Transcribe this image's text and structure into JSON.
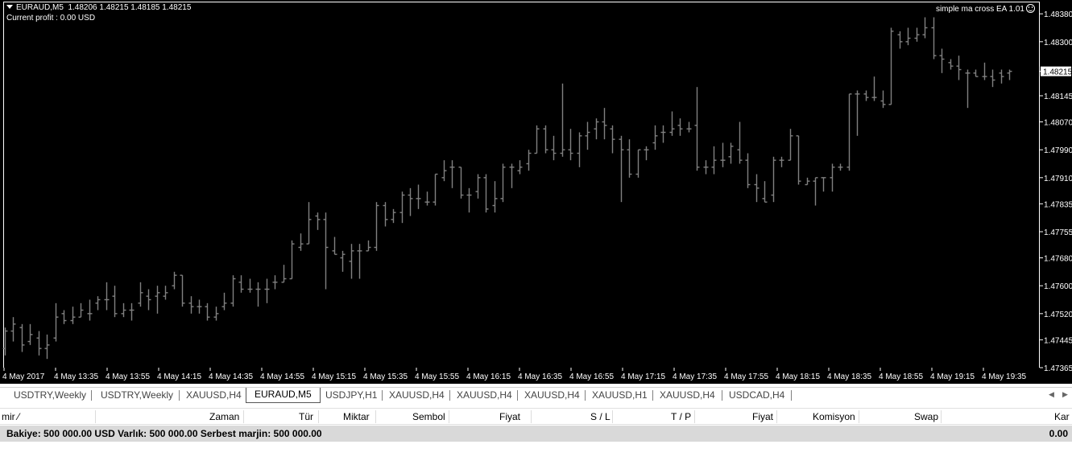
{
  "chart": {
    "info_line": "EURAUD,M5  1.48206 1.48215 1.48185 1.48215",
    "profit_line": "Current profit : 0.00 USD",
    "ea_label": "simple ma cross EA 1.01",
    "current_price": "1.48215",
    "bar_color": "#808080",
    "background": "#000000",
    "price_labels": [
      "1.48380",
      "1.48300",
      "1.48215",
      "1.48145",
      "1.48070",
      "1.47990",
      "1.47910",
      "1.47835",
      "1.47755",
      "1.47680",
      "1.47600",
      "1.47520",
      "1.47445",
      "1.47365"
    ],
    "time_labels": [
      "4 May 2017",
      "4 May 13:35",
      "4 May 13:55",
      "4 May 14:15",
      "4 May 14:35",
      "4 May 14:55",
      "4 May 15:15",
      "4 May 15:35",
      "4 May 15:55",
      "4 May 16:15",
      "4 May 16:35",
      "4 May 16:55",
      "4 May 17:15",
      "4 May 17:35",
      "4 May 17:55",
      "4 May 18:15",
      "4 May 18:35",
      "4 May 18:55",
      "4 May 19:15",
      "4 May 19:35"
    ]
  },
  "chart_data": {
    "type": "ohlc",
    "symbol": "EURAUD",
    "timeframe": "M5",
    "ylim": [
      1.47365,
      1.48415
    ],
    "bars": [
      [
        1.4742,
        1.4748,
        1.474,
        1.4747
      ],
      [
        1.4747,
        1.4751,
        1.4744,
        1.4749
      ],
      [
        1.4748,
        1.4749,
        1.4741,
        1.4743
      ],
      [
        1.4744,
        1.4749,
        1.4743,
        1.4746
      ],
      [
        1.4745,
        1.4747,
        1.474,
        1.4742
      ],
      [
        1.4742,
        1.4746,
        1.4739,
        1.4743
      ],
      [
        1.4745,
        1.4755,
        1.4744,
        1.4751
      ],
      [
        1.4752,
        1.4753,
        1.4749,
        1.475
      ],
      [
        1.475,
        1.4754,
        1.4749,
        1.4751
      ],
      [
        1.4751,
        1.4755,
        1.4751,
        1.4753
      ],
      [
        1.4752,
        1.4756,
        1.475,
        1.4752
      ],
      [
        1.4755,
        1.4757,
        1.4753,
        1.4756
      ],
      [
        1.4756,
        1.4761,
        1.4753,
        1.4756
      ],
      [
        1.4757,
        1.476,
        1.4751,
        1.4752
      ],
      [
        1.4752,
        1.4755,
        1.4751,
        1.4753
      ],
      [
        1.4753,
        1.4755,
        1.475,
        1.4753
      ],
      [
        1.4755,
        1.4761,
        1.4754,
        1.4758
      ],
      [
        1.4757,
        1.4759,
        1.4753,
        1.4756
      ],
      [
        1.4757,
        1.476,
        1.4752,
        1.4758
      ],
      [
        1.4757,
        1.476,
        1.4756,
        1.4758
      ],
      [
        1.476,
        1.4764,
        1.4759,
        1.4763
      ],
      [
        1.4763,
        1.4763,
        1.4754,
        1.4755
      ],
      [
        1.4755,
        1.4757,
        1.4752,
        1.4754
      ],
      [
        1.4754,
        1.4756,
        1.4752,
        1.4754
      ],
      [
        1.4754,
        1.4755,
        1.475,
        1.4751
      ],
      [
        1.4751,
        1.4754,
        1.475,
        1.4752
      ],
      [
        1.4754,
        1.4758,
        1.4753,
        1.4755
      ],
      [
        1.4755,
        1.4763,
        1.4754,
        1.4762
      ],
      [
        1.4761,
        1.4763,
        1.4758,
        1.4759
      ],
      [
        1.4759,
        1.4762,
        1.4758,
        1.4759
      ],
      [
        1.4759,
        1.4761,
        1.4754,
        1.4759
      ],
      [
        1.4759,
        1.4762,
        1.4755,
        1.4759
      ],
      [
        1.4761,
        1.4763,
        1.4759,
        1.4761
      ],
      [
        1.4761,
        1.4766,
        1.4761,
        1.4762
      ],
      [
        1.4762,
        1.4773,
        1.4762,
        1.4772
      ],
      [
        1.4771,
        1.4775,
        1.477,
        1.4772
      ],
      [
        1.4772,
        1.4784,
        1.4772,
        1.4779
      ],
      [
        1.478,
        1.4781,
        1.4776,
        1.4779
      ],
      [
        1.4779,
        1.4781,
        1.4759,
        1.4771
      ],
      [
        1.477,
        1.4774,
        1.4769,
        1.4769
      ],
      [
        1.4768,
        1.477,
        1.4764,
        1.4769
      ],
      [
        1.4767,
        1.4772,
        1.4762,
        1.477
      ],
      [
        1.477,
        1.4772,
        1.4762,
        1.477
      ],
      [
        1.477,
        1.4773,
        1.477,
        1.4771
      ],
      [
        1.4771,
        1.4784,
        1.477,
        1.4783
      ],
      [
        1.4783,
        1.4784,
        1.4777,
        1.4779
      ],
      [
        1.4779,
        1.4782,
        1.4778,
        1.4781
      ],
      [
        1.4781,
        1.4787,
        1.4778,
        1.4786
      ],
      [
        1.4786,
        1.4788,
        1.478,
        1.4785
      ],
      [
        1.4785,
        1.4789,
        1.4782,
        1.4785
      ],
      [
        1.4784,
        1.4787,
        1.4783,
        1.4784
      ],
      [
        1.4784,
        1.4792,
        1.4783,
        1.4792
      ],
      [
        1.4791,
        1.4796,
        1.479,
        1.4793
      ],
      [
        1.4794,
        1.4796,
        1.4788,
        1.4794
      ],
      [
        1.4794,
        1.4794,
        1.4785,
        1.4786
      ],
      [
        1.4786,
        1.4788,
        1.4781,
        1.4786
      ],
      [
        1.4787,
        1.4792,
        1.4785,
        1.4791
      ],
      [
        1.4791,
        1.4792,
        1.4781,
        1.4782
      ],
      [
        1.4783,
        1.479,
        1.4781,
        1.4785
      ],
      [
        1.4785,
        1.4795,
        1.4784,
        1.4794
      ],
      [
        1.4794,
        1.4795,
        1.4788,
        1.4794
      ],
      [
        1.4793,
        1.4796,
        1.4792,
        1.4794
      ],
      [
        1.4795,
        1.4799,
        1.4793,
        1.4798
      ],
      [
        1.4798,
        1.4806,
        1.4798,
        1.4805
      ],
      [
        1.4805,
        1.4806,
        1.4798,
        1.4799
      ],
      [
        1.4799,
        1.4803,
        1.4796,
        1.4798
      ],
      [
        1.4798,
        1.4818,
        1.4797,
        1.4799
      ],
      [
        1.4799,
        1.4805,
        1.4796,
        1.4798
      ],
      [
        1.4798,
        1.4804,
        1.4794,
        1.4803
      ],
      [
        1.4803,
        1.4807,
        1.4799,
        1.4804
      ],
      [
        1.4805,
        1.4808,
        1.4802,
        1.4807
      ],
      [
        1.4807,
        1.4811,
        1.4802,
        1.4806
      ],
      [
        1.4805,
        1.4806,
        1.4798,
        1.4802
      ],
      [
        1.4802,
        1.4803,
        1.4784,
        1.4799
      ],
      [
        1.4799,
        1.4802,
        1.4791,
        1.4792
      ],
      [
        1.4792,
        1.4799,
        1.4791,
        1.4799
      ],
      [
        1.4799,
        1.48,
        1.4796,
        1.4799
      ],
      [
        1.4801,
        1.4806,
        1.4799,
        1.4803
      ],
      [
        1.4804,
        1.4806,
        1.4801,
        1.4804
      ],
      [
        1.4804,
        1.481,
        1.4803,
        1.4805
      ],
      [
        1.4806,
        1.4808,
        1.4803,
        1.4805
      ],
      [
        1.4805,
        1.4807,
        1.4804,
        1.4805
      ],
      [
        1.4806,
        1.4817,
        1.4793,
        1.4794
      ],
      [
        1.4794,
        1.4796,
        1.4792,
        1.4794
      ],
      [
        1.4794,
        1.48,
        1.4792,
        1.4796
      ],
      [
        1.4796,
        1.4801,
        1.4794,
        1.4796
      ],
      [
        1.4797,
        1.4801,
        1.4795,
        1.48
      ],
      [
        1.4799,
        1.4807,
        1.4795,
        1.4796
      ],
      [
        1.4796,
        1.4798,
        1.4788,
        1.4789
      ],
      [
        1.4789,
        1.4792,
        1.4784,
        1.4788
      ],
      [
        1.4785,
        1.479,
        1.4784,
        1.4784
      ],
      [
        1.4786,
        1.4797,
        1.4784,
        1.4796
      ],
      [
        1.4796,
        1.4797,
        1.4794,
        1.4796
      ],
      [
        1.4796,
        1.4805,
        1.4796,
        1.4803
      ],
      [
        1.4803,
        1.4803,
        1.4789,
        1.479
      ],
      [
        1.4789,
        1.4791,
        1.4789,
        1.479
      ],
      [
        1.479,
        1.4791,
        1.4783,
        1.4791
      ],
      [
        1.4791,
        1.4791,
        1.4787,
        1.4791
      ],
      [
        1.4791,
        1.4795,
        1.4787,
        1.4794
      ],
      [
        1.4794,
        1.4795,
        1.4793,
        1.4794
      ],
      [
        1.4794,
        1.4815,
        1.4793,
        1.4815
      ],
      [
        1.4815,
        1.4816,
        1.4803,
        1.4815
      ],
      [
        1.4815,
        1.4816,
        1.4813,
        1.4814
      ],
      [
        1.4814,
        1.482,
        1.4813,
        1.4814
      ],
      [
        1.4813,
        1.4816,
        1.4811,
        1.4812
      ],
      [
        1.4812,
        1.4834,
        1.4812,
        1.4833
      ],
      [
        1.4832,
        1.4833,
        1.4828,
        1.483
      ],
      [
        1.483,
        1.4834,
        1.4829,
        1.4831
      ],
      [
        1.4831,
        1.4834,
        1.483,
        1.4832
      ],
      [
        1.4832,
        1.4837,
        1.4831,
        1.4834
      ],
      [
        1.4834,
        1.4837,
        1.4825,
        1.4826
      ],
      [
        1.4826,
        1.4828,
        1.4821,
        1.4825
      ],
      [
        1.4824,
        1.4825,
        1.4822,
        1.4823
      ],
      [
        1.4823,
        1.4826,
        1.4819,
        1.4822
      ],
      [
        1.4821,
        1.4822,
        1.4811,
        1.4821
      ],
      [
        1.4821,
        1.4822,
        1.482,
        1.482
      ],
      [
        1.482,
        1.4824,
        1.4819,
        1.482
      ],
      [
        1.482,
        1.4822,
        1.4817,
        1.4819
      ],
      [
        1.4821,
        1.4822,
        1.4818,
        1.482
      ],
      [
        1.4821,
        1.4822,
        1.4819,
        1.48215
      ]
    ]
  },
  "tabs": [
    {
      "label": "USDTRY,Weekly",
      "active": false
    },
    {
      "label": "USDTRY,Weekly",
      "active": false
    },
    {
      "label": "XAUUSD,H4",
      "active": false
    },
    {
      "label": "EURAUD,M5",
      "active": true
    },
    {
      "label": "USDJPY,H1",
      "active": false
    },
    {
      "label": "XAUUSD,H4",
      "active": false
    },
    {
      "label": "XAUUSD,H4",
      "active": false
    },
    {
      "label": "XAUUSD,H4",
      "active": false
    },
    {
      "label": "XAUUSD,H1",
      "active": false
    },
    {
      "label": "XAUUSD,H4",
      "active": false
    },
    {
      "label": "USDCAD,H4",
      "active": false
    }
  ],
  "nav": {
    "left": "◀",
    "right": "▶"
  },
  "terminal": {
    "columns": {
      "order": "mir  ⁄",
      "time": "Zaman",
      "type": "Tür",
      "size": "Miktar",
      "symbol": "Sembol",
      "price": "Fiyat",
      "sl": "S / L",
      "tp": "T / P",
      "price2": "Fiyat",
      "commission": "Komisyon",
      "swap": "Swap",
      "profit": "Kar"
    },
    "balance_line": "Bakiye: 500 000.00 USD  Varlık: 500 000.00  Serbest marjin: 500 000.00",
    "total_profit": "0.00"
  }
}
